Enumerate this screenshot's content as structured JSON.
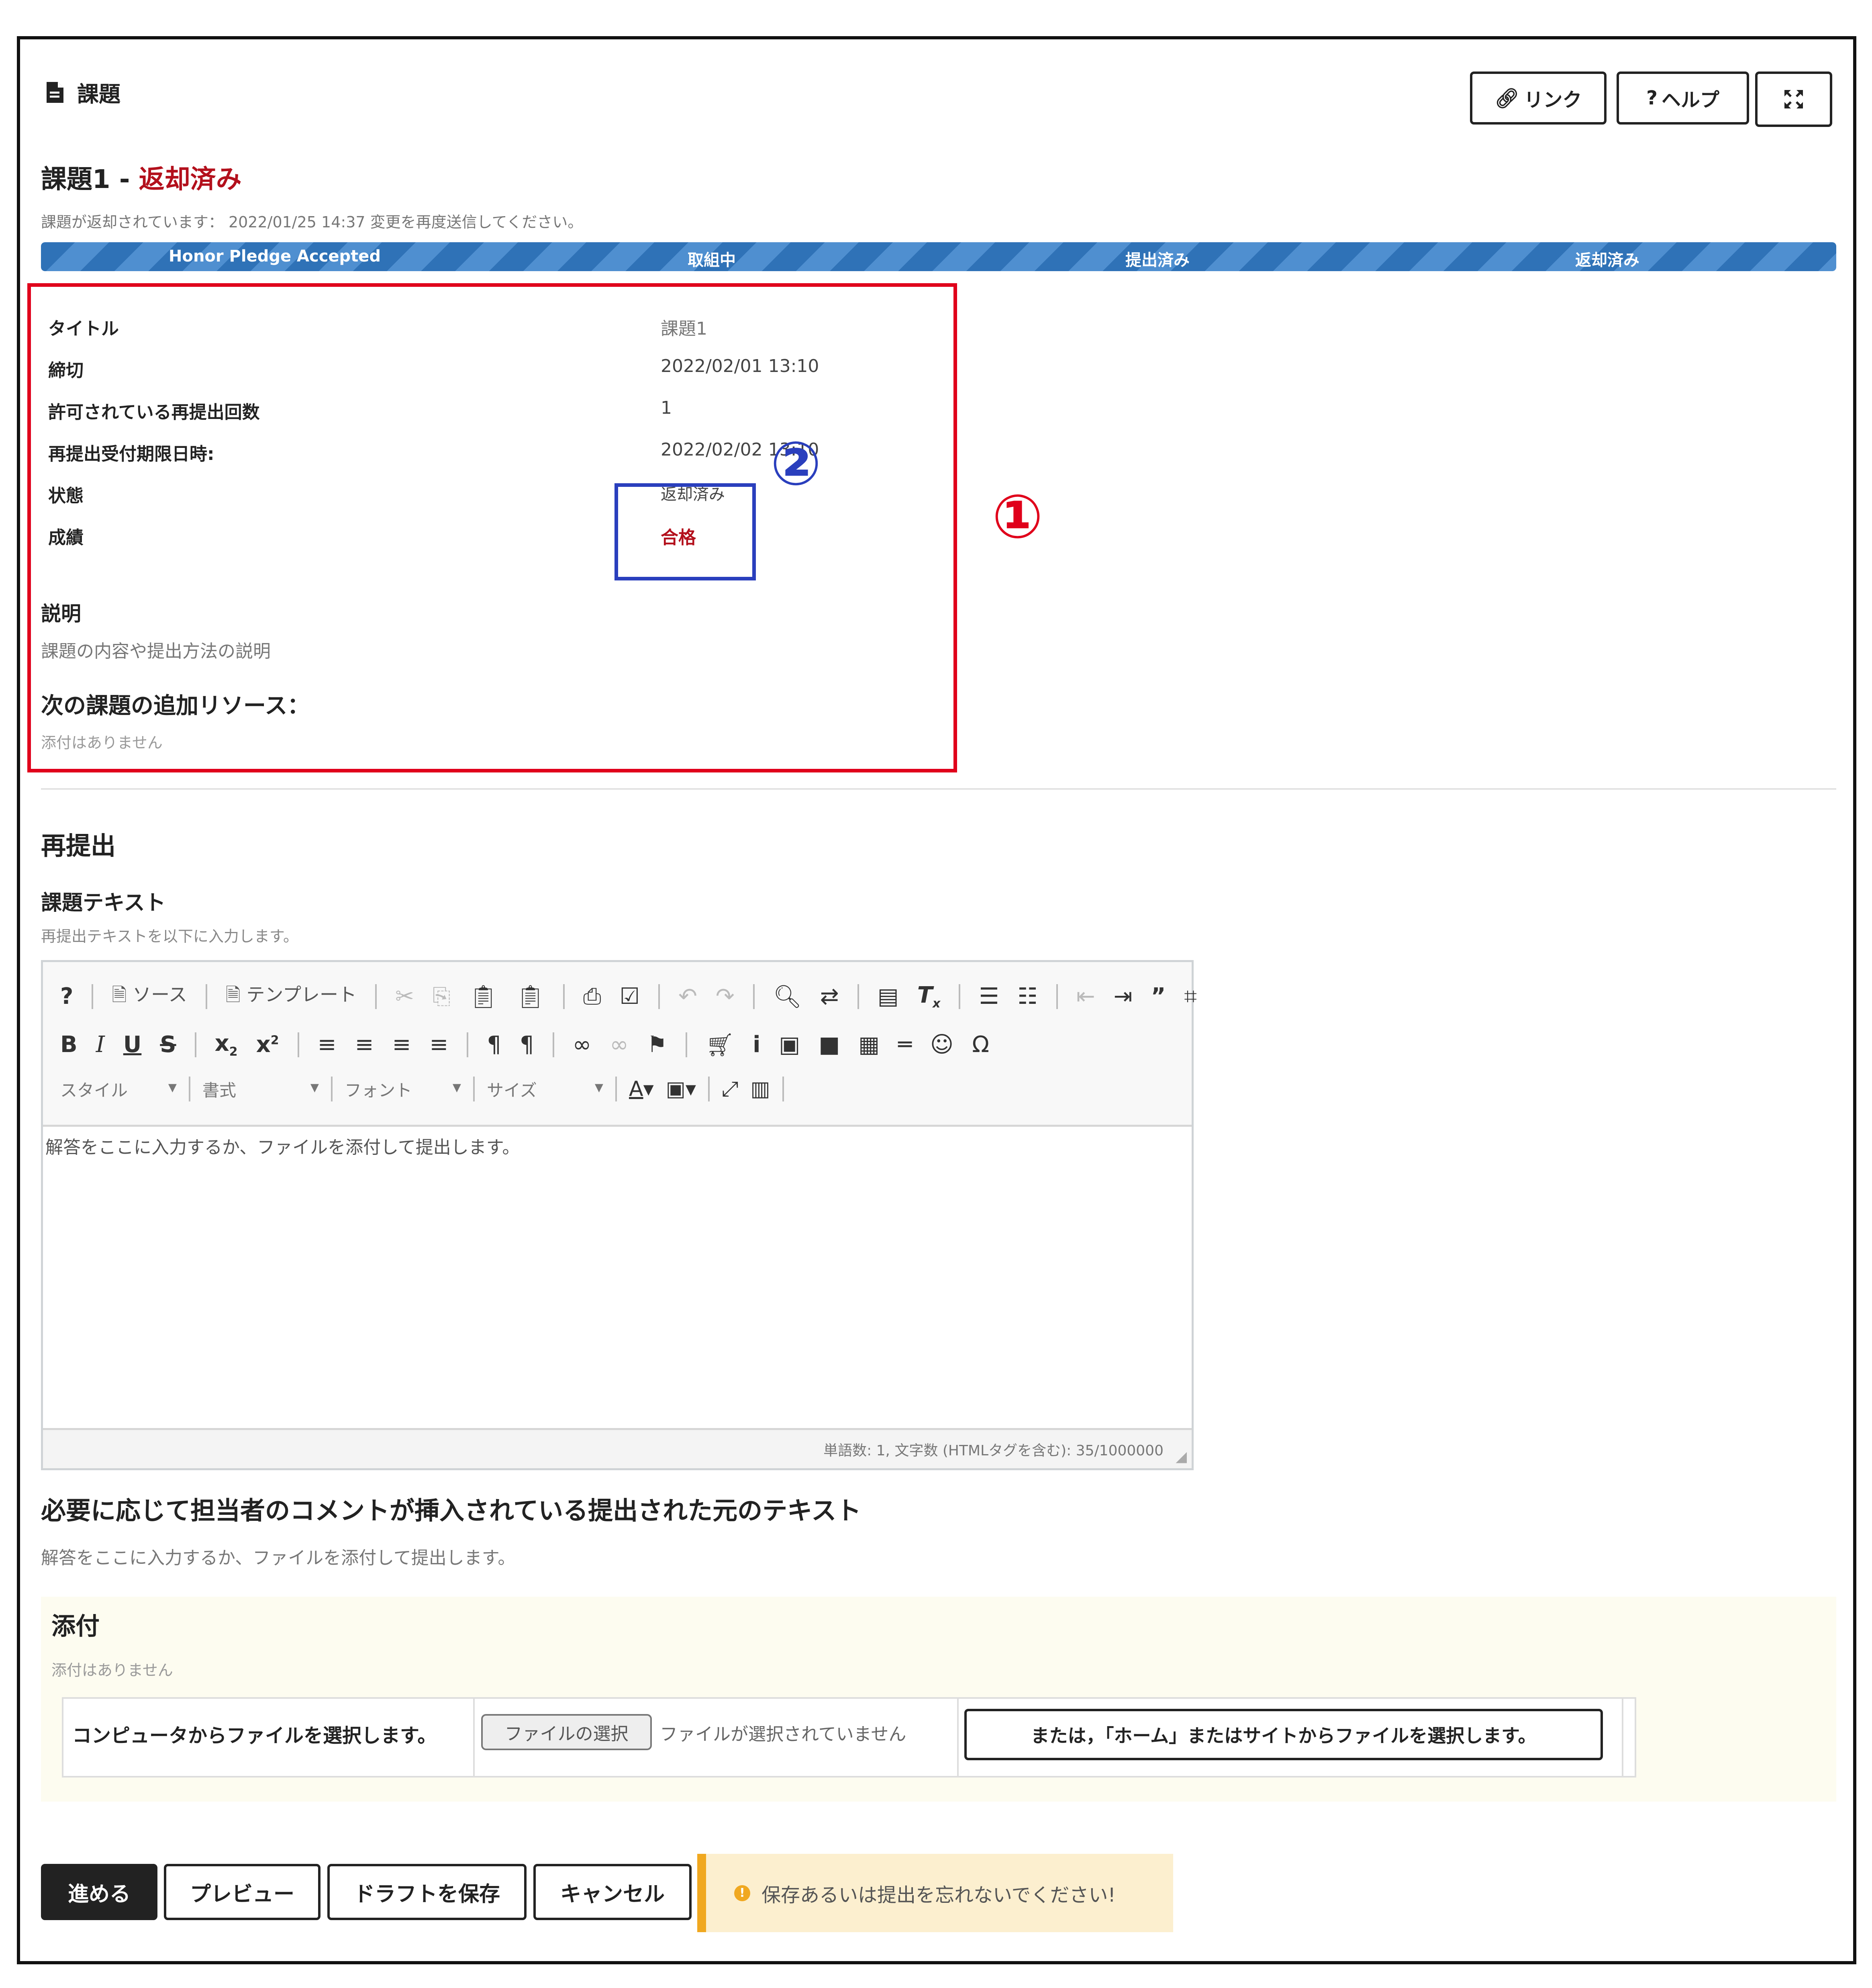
{
  "header": {
    "page_icon": "document-icon",
    "page_title": "課題",
    "link_button": "リンク",
    "help_button": "ヘルプ",
    "fullscreen_icon": "expand-icon"
  },
  "assignment": {
    "name": "課題1",
    "dash": " - ",
    "status_heading": "返却済み",
    "returned_notice": "課題が返却されています： 2022/01/25 14:37 変更を再度送信してください。"
  },
  "progress": {
    "steps": [
      "Honor Pledge Accepted",
      "取組中",
      "提出済み",
      "返却済み"
    ]
  },
  "details": {
    "rows": [
      {
        "label": "タイトル",
        "value": "課題1"
      },
      {
        "label": "締切",
        "value": "2022/02/01 13:10"
      },
      {
        "label": "許可されている再提出回数",
        "value": "1"
      },
      {
        "label": "再提出受付期限日時:",
        "value": "2022/02/02 13:10"
      },
      {
        "label": "状態",
        "value": "返却済み"
      },
      {
        "label": "成績",
        "value": "合格"
      }
    ],
    "description_heading": "説明",
    "description_text": "課題の内容や提出方法の説明",
    "resources_heading": "次の課題の追加リソース：",
    "resources_text": "添付はありません"
  },
  "annotations": {
    "marker_1": "①",
    "marker_2": "②"
  },
  "resubmit": {
    "heading": "再提出",
    "text_heading": "課題テキスト",
    "text_hint": "再提出テキストを以下に入力します。",
    "toolbar": {
      "source_label": "ソース",
      "template_label": "テンプレート",
      "style_select": "スタイル",
      "format_select": "書式",
      "font_select": "フォント",
      "size_select": "サイズ"
    },
    "editor_content": "解答をここに入力するか、ファイルを添付して提出します。",
    "editor_status": "単語数: 1, 文字数 (HTMLタグを含む): 35/1000000"
  },
  "original": {
    "heading": "必要に応じて担当者のコメントが挿入されている提出された元のテキスト",
    "text": "解答をここに入力するか、ファイルを添付して提出します。"
  },
  "attachments": {
    "heading": "添付",
    "none_text": "添付はありません",
    "computer_label": "コンピュータからファイルを選択します。",
    "choose_file_button": "ファイルの選択",
    "no_file_text": "ファイルが選択されていません",
    "home_button": "または，「ホーム」またはサイトからファイルを選択します。"
  },
  "actions": {
    "submit": "進める",
    "preview": "プレビュー",
    "save_draft": "ドラフトを保存",
    "cancel": "キャンセル",
    "warning": "保存あるいは提出を忘れないでください!"
  },
  "colors": {
    "status_red": "#b3101c",
    "annotation_red": "#e0001b",
    "annotation_blue": "#2a3fbd",
    "progress_blue": "#2f72b7",
    "warning_amber": "#f0a820"
  }
}
